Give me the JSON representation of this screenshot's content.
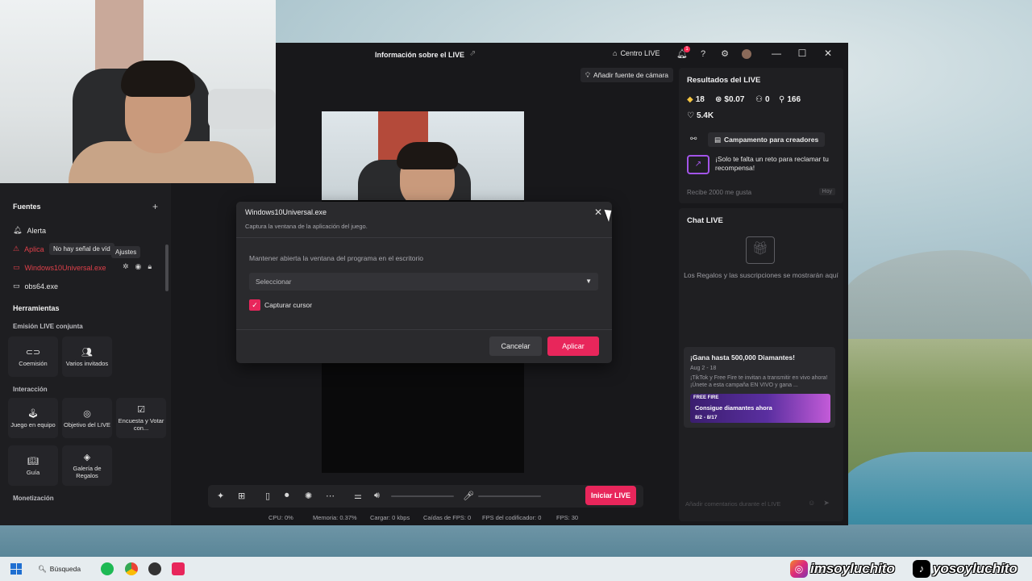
{
  "window": {
    "title": "Información sobre el LIVE",
    "centro_live": "Centro LIVE",
    "notification_count": "1"
  },
  "preview": {
    "add_camera_label": "Añadir fuente de cámara"
  },
  "sources": {
    "heading": "Fuentes",
    "items": [
      {
        "label": "Alerta",
        "icon": "bell-icon"
      },
      {
        "label": "Aplica",
        "icon": "warning-icon"
      },
      {
        "label": "Windows10Universal.exe",
        "icon": "window-icon"
      },
      {
        "label": "obs64.exe",
        "icon": "window-icon"
      }
    ],
    "tooltip_no_signal": "No hay señal de víd",
    "tooltip_settings": "Ajustes"
  },
  "tools": {
    "heading": "Herramientas",
    "joint_heading": "Emisión LIVE conjunta",
    "joint": [
      {
        "label": "Coemisión",
        "icon": "link-icon"
      },
      {
        "label": "Varios invitados",
        "icon": "users-icon"
      }
    ],
    "interaction_heading": "Interacción",
    "interaction": [
      {
        "label": "Juego en equipo",
        "icon": "joystick-icon"
      },
      {
        "label": "Objetivo del LIVE",
        "icon": "target-icon"
      },
      {
        "label": "Encuesta y Votar con...",
        "icon": "poll-icon"
      },
      {
        "label": "Guía",
        "icon": "book-icon"
      },
      {
        "label": "Galería de Regalos",
        "icon": "gift-gallery-icon"
      }
    ],
    "monetization_heading": "Monetización"
  },
  "controls": {
    "go_live": "Iniciar LIVE"
  },
  "stats": {
    "cpu": "CPU: 0%",
    "memory": "Memoria: 0.37%",
    "load": "Cargar: 0 kbps",
    "fps_drops": "Caídas de FPS: 0",
    "encoder_fps": "FPS del codificador: 0",
    "fps": "FPS: 30"
  },
  "results": {
    "title": "Resultados del LIVE",
    "diamonds": "18",
    "earnings": "$0.07",
    "viewers": "0",
    "followers": "166",
    "likes": "5.4K",
    "campaign_button": "Campamento para creadores",
    "challenge_text": "¡Solo te falta un reto para reclamar tu recompensa!",
    "receive_text": "Recibe 2000 me gusta",
    "today_badge": "Hoy"
  },
  "chat": {
    "title": "Chat LIVE",
    "gifts_message": "Los Regalos y las suscripciones se mostrarán aquí",
    "promo_title": "¡Gana hasta 500,000 Diamantes!",
    "promo_date": "Aug 2 - 18",
    "promo_desc": "¡TikTok y Free Fire te invitan a transmitir en vivo ahora! ¡Únete a esta campaña EN VIVO y gana ...",
    "banner_logo": "FREE FIRE",
    "banner_text": "Consigue diamantes ahora",
    "banner_date": "8/2 - 8/17",
    "comment_placeholder": "Añadir comentarios durante el LIVE"
  },
  "modal": {
    "title": "Windows10Universal.exe",
    "subtitle": "Captura la ventana de la aplicación del juego.",
    "label": "Mantener abierta la ventana del programa en el escritorio",
    "select_placeholder": "Seleccionar",
    "capture_cursor": "Capturar cursor",
    "capture_cursor_checked": true,
    "cancel": "Cancelar",
    "apply": "Aplicar"
  },
  "taskbar": {
    "search": "Búsqueda"
  },
  "overlay": {
    "instagram_handle": "imsoyluchito",
    "tiktok_handle": "yosoyluchito"
  },
  "colors": {
    "accent": "#e8265b",
    "error": "#e0404a",
    "background": "#18181b"
  }
}
